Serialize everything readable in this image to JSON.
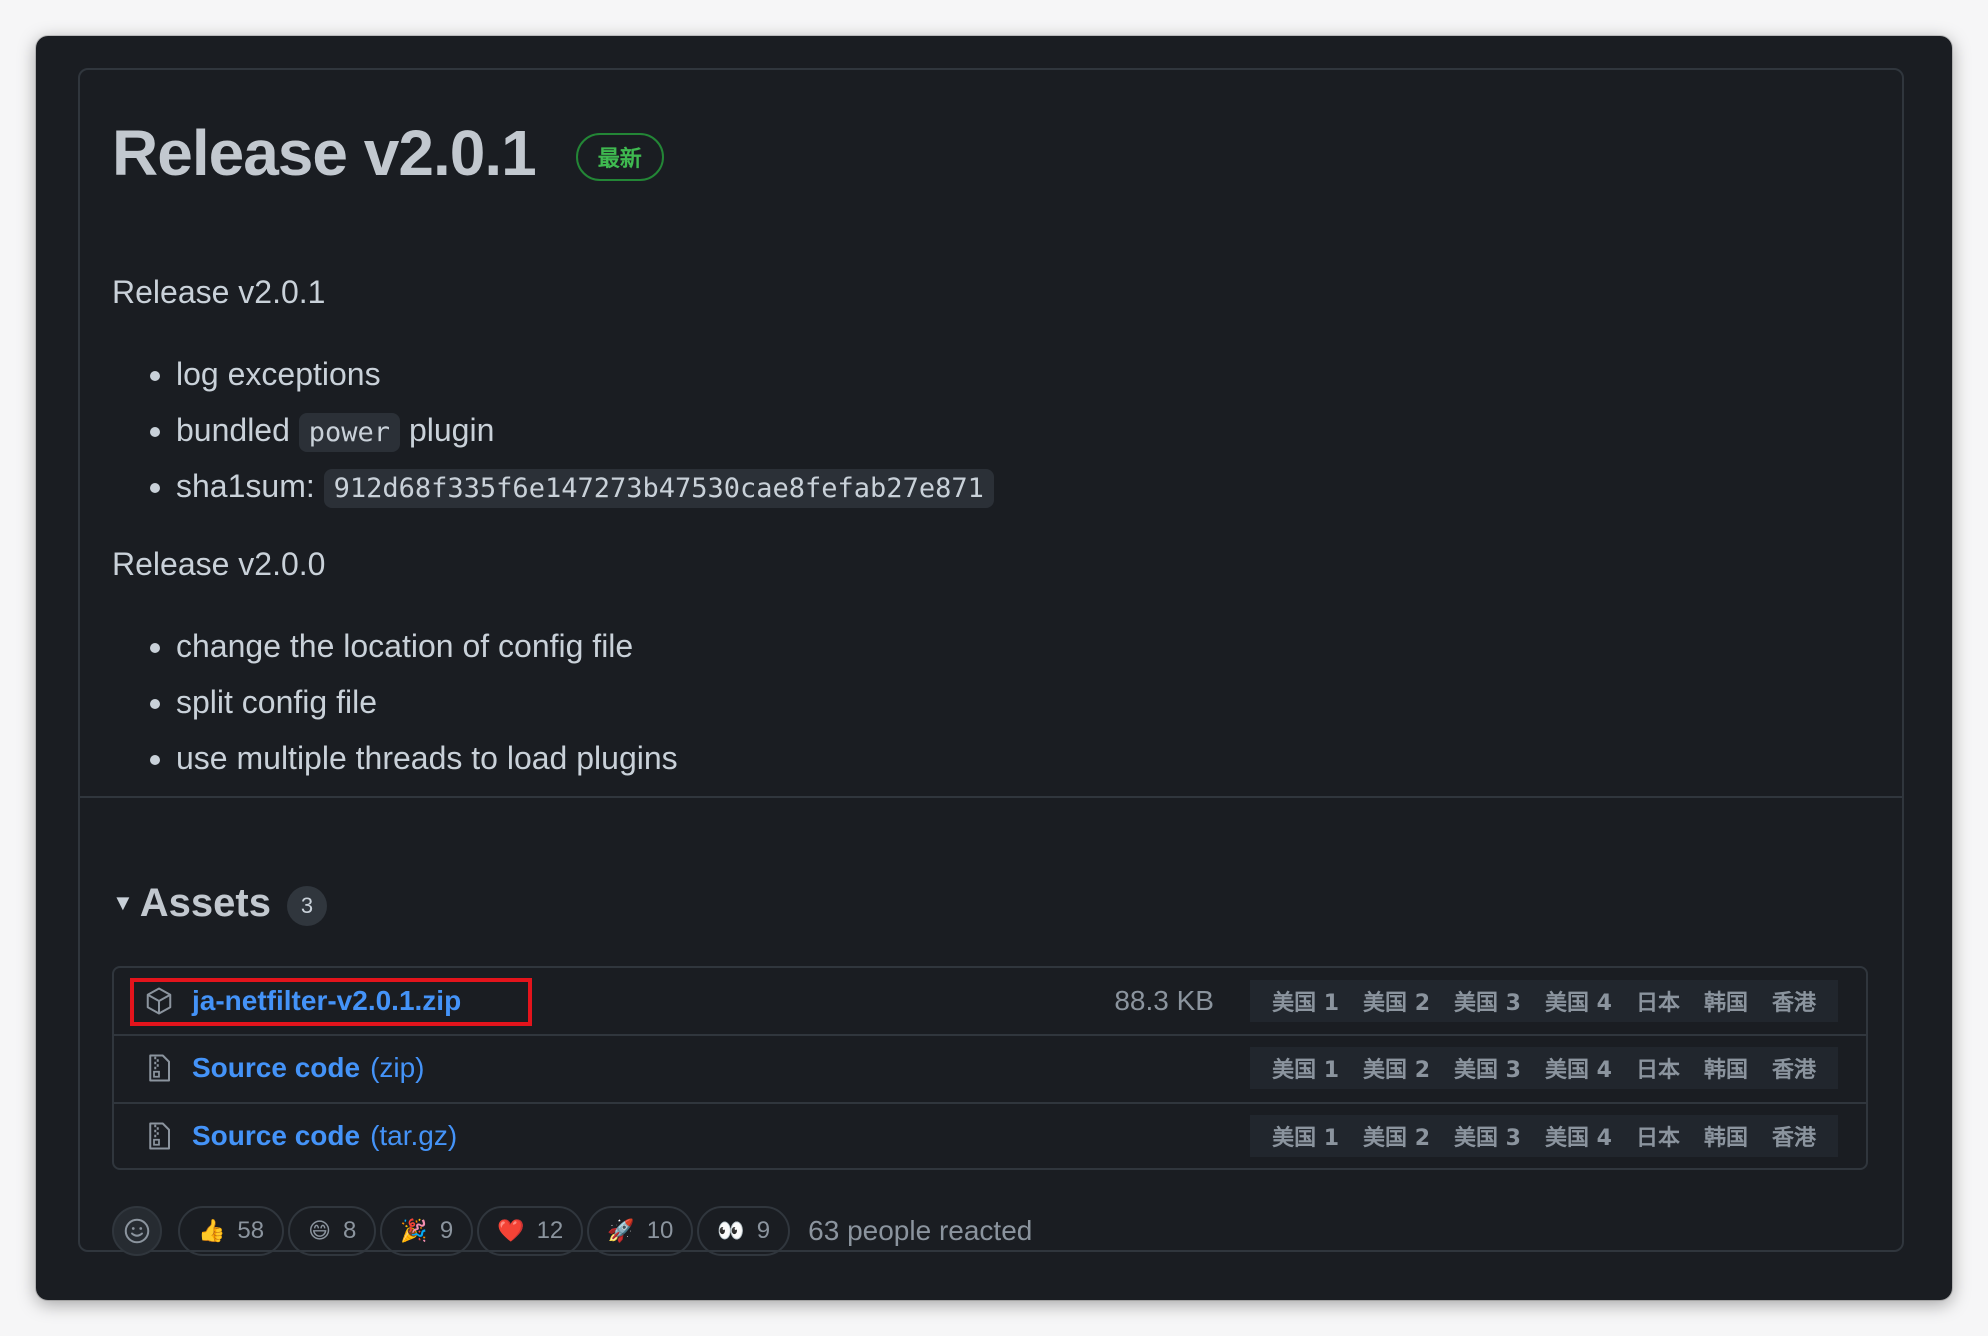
{
  "release": {
    "title": "Release v2.0.1",
    "latest_badge": "最新"
  },
  "notes": {
    "heading_1": "Release v2.0.1",
    "items_1": [
      {
        "text": "log exceptions"
      },
      {
        "before": "bundled",
        "code": "power",
        "after": "plugin"
      },
      {
        "before": "sha1sum:",
        "code": "912d68f335f6e147273b47530cae8fefab27e871"
      }
    ],
    "heading_2": "Release v2.0.0",
    "items_2": [
      "change the location of config file",
      "split config file",
      "use multiple threads to load plugins"
    ]
  },
  "assets": {
    "title": "Assets",
    "count": "3",
    "rows": [
      {
        "name": "ja-netfilter-v2.0.1.zip",
        "suffix": "",
        "size": "88.3 KB",
        "icon": "package-icon",
        "highlighted": true
      },
      {
        "name": "Source code",
        "suffix": "(zip)",
        "size": "",
        "icon": "file-zip-icon"
      },
      {
        "name": "Source code",
        "suffix": "(tar.gz)",
        "size": "",
        "icon": "file-zip-icon"
      }
    ],
    "mirrors": [
      "美国 1",
      "美国 2",
      "美国 3",
      "美国 4",
      "日本",
      "韩国",
      "香港"
    ]
  },
  "reactions": {
    "items": [
      {
        "emoji": "👍",
        "name": "thumbs-up",
        "count": "58"
      },
      {
        "emoji": "😄",
        "name": "laugh",
        "count": "8"
      },
      {
        "emoji": "🎉",
        "name": "hooray",
        "count": "9"
      },
      {
        "emoji": "❤️",
        "name": "heart",
        "count": "12"
      },
      {
        "emoji": "🚀",
        "name": "rocket",
        "count": "10"
      },
      {
        "emoji": "👀",
        "name": "eyes",
        "count": "9"
      }
    ],
    "summary": "63 people reacted"
  },
  "colors": {
    "background": "#1a1d22",
    "link": "#4493f8",
    "latest_badge": "#3fb950",
    "highlight_box": "#e3141c"
  }
}
